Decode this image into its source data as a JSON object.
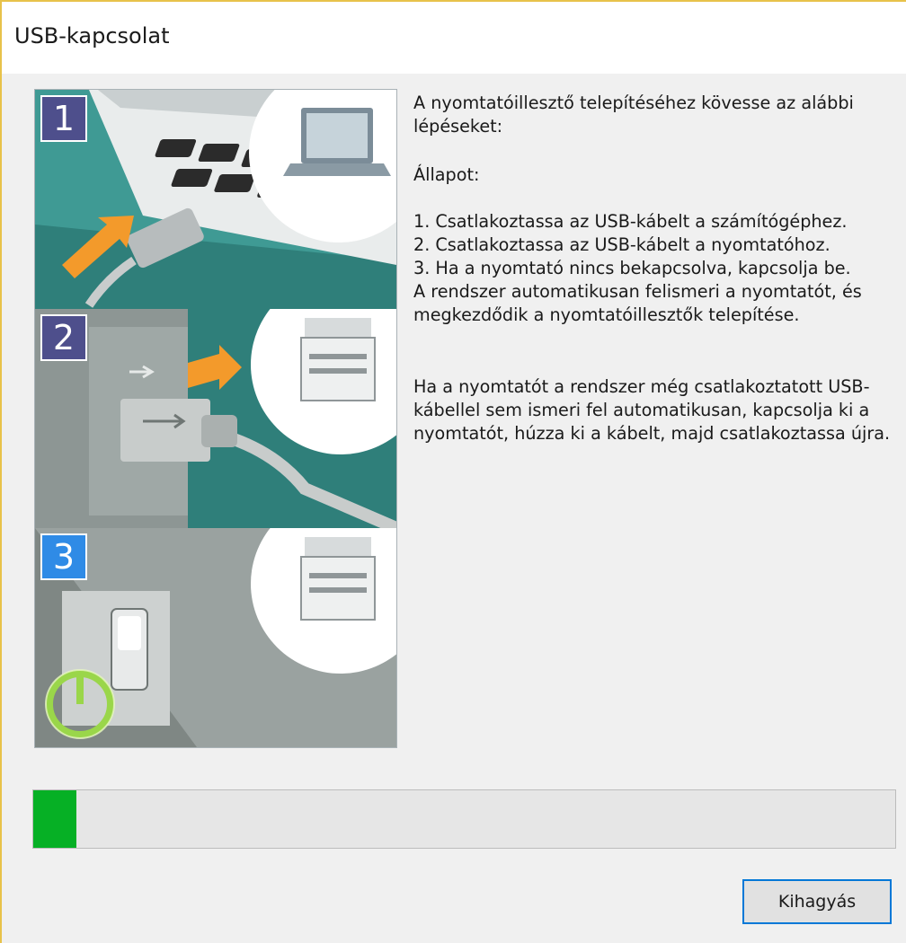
{
  "window": {
    "title": "USB-kapcsolat"
  },
  "steps": [
    {
      "number": "1",
      "icon": "laptop-icon"
    },
    {
      "number": "2",
      "icon": "printer-icon"
    },
    {
      "number": "3",
      "icon": "power-icon"
    }
  ],
  "instructions": {
    "intro": "A nyomtatóillesztő telepítéséhez kövesse az alábbi lépéseket:",
    "status_label": "Állapot:",
    "step1": "1. Csatlakoztassa az USB-kábelt a számítógéphez.",
    "step2": "2. Csatlakoztassa az USB-kábelt a nyomtatóhoz.",
    "step3": "3. Ha a nyomtató nincs bekapcsolva, kapcsolja be.",
    "auto_detect": "A rendszer automatikusan felismeri a nyomtatót, és megkezdődik a nyomtatóillesztők telepítése.",
    "note": "Ha a nyomtatót a rendszer még csatlakoztatott USB-kábellel sem ismeri fel automatikusan, kapcsolja ki a nyomtatót, húzza ki a kábelt, majd csatlakoztassa újra."
  },
  "progress": {
    "value_percent": 5,
    "color": "#06b025"
  },
  "buttons": {
    "skip_label": "Kihagyás"
  }
}
